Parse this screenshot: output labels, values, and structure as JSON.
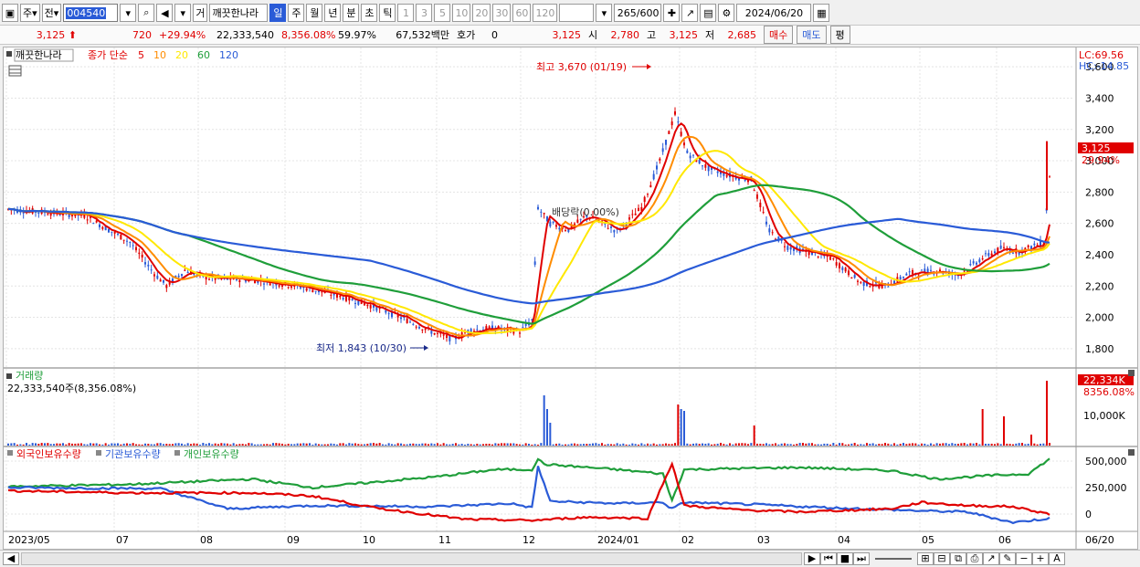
{
  "toolbar": {
    "market_btn": "주",
    "prev_btn": "전",
    "code": "004540",
    "stock_btn": "거",
    "stock_name": "깨끗한나라",
    "periods": [
      "일",
      "주",
      "월",
      "년",
      "분",
      "초",
      "틱"
    ],
    "period_selected": "일",
    "intervals": [
      "1",
      "3",
      "5",
      "10",
      "20",
      "30",
      "60",
      "120"
    ],
    "count": "265",
    "count_max": "/600",
    "date": "2024/06/20"
  },
  "info": {
    "price": "3,125",
    "change": "720",
    "change_pct": "+29.94%",
    "volume": "22,333,540",
    "volume_pct": "8,356.08%",
    "ratio": "59.97%",
    "amount": "67,532백만",
    "quote_label": "호가",
    "quote_val": "0",
    "last": "3,125",
    "open_label": "시",
    "open": "2,780",
    "high_label": "고",
    "high": "3,125",
    "low_label": "저",
    "low": "2,685",
    "buy_btn": "매수",
    "sell_btn": "매도",
    "eval_btn": "평"
  },
  "price_panel": {
    "stock_name": "깨끗한나라",
    "ma_title": "종가 단순",
    "ma_periods": [
      "5",
      "10",
      "20",
      "60",
      "120"
    ],
    "ma_colors": [
      "#e00000",
      "#ff8c00",
      "#ffe800",
      "#1f9e3a",
      "#2a5bd7"
    ],
    "lc": "LC:69.56",
    "hc": "HC:-14.85",
    "high_annotation": "최고 3,670 (01/19)",
    "low_annotation": "최저 1,843 (10/30)",
    "dividend_annotation": "배당락(0.00%)",
    "last_price_label": "3,125",
    "last_change_label": "29.94%",
    "y_ticks": [
      "3,600",
      "3,400",
      "3,200",
      "3,000",
      "2,800",
      "2,600",
      "2,400",
      "2,200",
      "2,000",
      "1,800"
    ]
  },
  "volume_panel": {
    "title": "거래량",
    "value": "22,333,540주(8,356.08%)",
    "last_label": "22,334K",
    "last_pct": "8356.08%",
    "tick": "10,000K"
  },
  "holding_panel": {
    "series": [
      "외국인보유수량",
      "기관보유수량",
      "개인보유수량"
    ],
    "colors": [
      "#e00000",
      "#2a5bd7",
      "#1f9e3a"
    ],
    "y_ticks": [
      "500,000",
      "250,000",
      "0"
    ]
  },
  "x_axis": [
    "2023/05",
    "07",
    "08",
    "09",
    "10",
    "11",
    "12",
    "2024/01",
    "02",
    "03",
    "04",
    "05",
    "06",
    "06/20"
  ]
}
